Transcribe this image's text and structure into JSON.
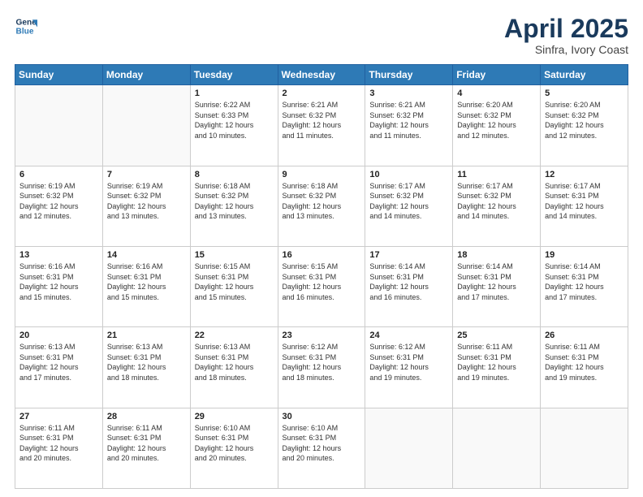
{
  "header": {
    "logo_line1": "General",
    "logo_line2": "Blue",
    "month": "April 2025",
    "location": "Sinfra, Ivory Coast"
  },
  "days_of_week": [
    "Sunday",
    "Monday",
    "Tuesday",
    "Wednesday",
    "Thursday",
    "Friday",
    "Saturday"
  ],
  "weeks": [
    [
      {
        "day": "",
        "info": ""
      },
      {
        "day": "",
        "info": ""
      },
      {
        "day": "1",
        "info": "Sunrise: 6:22 AM\nSunset: 6:33 PM\nDaylight: 12 hours\nand 10 minutes."
      },
      {
        "day": "2",
        "info": "Sunrise: 6:21 AM\nSunset: 6:32 PM\nDaylight: 12 hours\nand 11 minutes."
      },
      {
        "day": "3",
        "info": "Sunrise: 6:21 AM\nSunset: 6:32 PM\nDaylight: 12 hours\nand 11 minutes."
      },
      {
        "day": "4",
        "info": "Sunrise: 6:20 AM\nSunset: 6:32 PM\nDaylight: 12 hours\nand 12 minutes."
      },
      {
        "day": "5",
        "info": "Sunrise: 6:20 AM\nSunset: 6:32 PM\nDaylight: 12 hours\nand 12 minutes."
      }
    ],
    [
      {
        "day": "6",
        "info": "Sunrise: 6:19 AM\nSunset: 6:32 PM\nDaylight: 12 hours\nand 12 minutes."
      },
      {
        "day": "7",
        "info": "Sunrise: 6:19 AM\nSunset: 6:32 PM\nDaylight: 12 hours\nand 13 minutes."
      },
      {
        "day": "8",
        "info": "Sunrise: 6:18 AM\nSunset: 6:32 PM\nDaylight: 12 hours\nand 13 minutes."
      },
      {
        "day": "9",
        "info": "Sunrise: 6:18 AM\nSunset: 6:32 PM\nDaylight: 12 hours\nand 13 minutes."
      },
      {
        "day": "10",
        "info": "Sunrise: 6:17 AM\nSunset: 6:32 PM\nDaylight: 12 hours\nand 14 minutes."
      },
      {
        "day": "11",
        "info": "Sunrise: 6:17 AM\nSunset: 6:32 PM\nDaylight: 12 hours\nand 14 minutes."
      },
      {
        "day": "12",
        "info": "Sunrise: 6:17 AM\nSunset: 6:31 PM\nDaylight: 12 hours\nand 14 minutes."
      }
    ],
    [
      {
        "day": "13",
        "info": "Sunrise: 6:16 AM\nSunset: 6:31 PM\nDaylight: 12 hours\nand 15 minutes."
      },
      {
        "day": "14",
        "info": "Sunrise: 6:16 AM\nSunset: 6:31 PM\nDaylight: 12 hours\nand 15 minutes."
      },
      {
        "day": "15",
        "info": "Sunrise: 6:15 AM\nSunset: 6:31 PM\nDaylight: 12 hours\nand 15 minutes."
      },
      {
        "day": "16",
        "info": "Sunrise: 6:15 AM\nSunset: 6:31 PM\nDaylight: 12 hours\nand 16 minutes."
      },
      {
        "day": "17",
        "info": "Sunrise: 6:14 AM\nSunset: 6:31 PM\nDaylight: 12 hours\nand 16 minutes."
      },
      {
        "day": "18",
        "info": "Sunrise: 6:14 AM\nSunset: 6:31 PM\nDaylight: 12 hours\nand 17 minutes."
      },
      {
        "day": "19",
        "info": "Sunrise: 6:14 AM\nSunset: 6:31 PM\nDaylight: 12 hours\nand 17 minutes."
      }
    ],
    [
      {
        "day": "20",
        "info": "Sunrise: 6:13 AM\nSunset: 6:31 PM\nDaylight: 12 hours\nand 17 minutes."
      },
      {
        "day": "21",
        "info": "Sunrise: 6:13 AM\nSunset: 6:31 PM\nDaylight: 12 hours\nand 18 minutes."
      },
      {
        "day": "22",
        "info": "Sunrise: 6:13 AM\nSunset: 6:31 PM\nDaylight: 12 hours\nand 18 minutes."
      },
      {
        "day": "23",
        "info": "Sunrise: 6:12 AM\nSunset: 6:31 PM\nDaylight: 12 hours\nand 18 minutes."
      },
      {
        "day": "24",
        "info": "Sunrise: 6:12 AM\nSunset: 6:31 PM\nDaylight: 12 hours\nand 19 minutes."
      },
      {
        "day": "25",
        "info": "Sunrise: 6:11 AM\nSunset: 6:31 PM\nDaylight: 12 hours\nand 19 minutes."
      },
      {
        "day": "26",
        "info": "Sunrise: 6:11 AM\nSunset: 6:31 PM\nDaylight: 12 hours\nand 19 minutes."
      }
    ],
    [
      {
        "day": "27",
        "info": "Sunrise: 6:11 AM\nSunset: 6:31 PM\nDaylight: 12 hours\nand 20 minutes."
      },
      {
        "day": "28",
        "info": "Sunrise: 6:11 AM\nSunset: 6:31 PM\nDaylight: 12 hours\nand 20 minutes."
      },
      {
        "day": "29",
        "info": "Sunrise: 6:10 AM\nSunset: 6:31 PM\nDaylight: 12 hours\nand 20 minutes."
      },
      {
        "day": "30",
        "info": "Sunrise: 6:10 AM\nSunset: 6:31 PM\nDaylight: 12 hours\nand 20 minutes."
      },
      {
        "day": "",
        "info": ""
      },
      {
        "day": "",
        "info": ""
      },
      {
        "day": "",
        "info": ""
      }
    ]
  ]
}
